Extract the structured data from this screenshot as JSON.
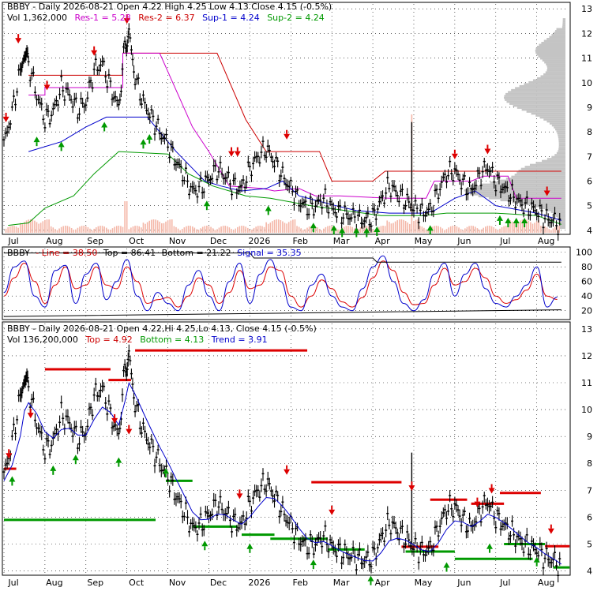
{
  "colors": {
    "bg": "#ffffff",
    "grid": "#000000",
    "price": "#000000",
    "volume": "#f4b7a8",
    "res1": "#cc00cc",
    "res2": "#cc0000",
    "sup1": "#0000cc",
    "sup2": "#009900",
    "profile": "#c4c4c4",
    "arrow_up": "#009900",
    "arrow_down": "#dd0000",
    "stoch_line": "#0000cc",
    "stoch_signal": "#dd0000",
    "stoch_bounds": "#000000",
    "top_line": "#dd0000",
    "bottom_line": "#009900",
    "trend_line": "#0000cc"
  },
  "months": [
    {
      "label": "Jul",
      "x": 0.0
    },
    {
      "label": "Aug",
      "x": 1.0
    },
    {
      "label": "Sep",
      "x": 2.0
    },
    {
      "label": "Oct",
      "x": 3.0
    },
    {
      "label": "Nov",
      "x": 4.0
    },
    {
      "label": "Dec",
      "x": 5.0
    },
    {
      "label": "2026",
      "x": 6.0
    },
    {
      "label": "Feb",
      "x": 7.0
    },
    {
      "label": "Mar",
      "x": 8.0
    },
    {
      "label": "Apr",
      "x": 9.0
    },
    {
      "label": "May",
      "x": 10.0
    },
    {
      "label": "Jun",
      "x": 11.0
    },
    {
      "label": "Jul",
      "x": 12.0
    },
    {
      "label": "Aug",
      "x": 13.0
    }
  ],
  "panel1": {
    "header": {
      "title": "BBBY - Daily 2026-08-21 Open 4.22  High 4.25  Low 4.13  Close 4.15 (-0.5%)",
      "vol": "Vol 1,362,000",
      "res1": "Res-1 = 5.28",
      "res2": "Res-2 = 6.37",
      "sup1": "Sup-1 = 4.24",
      "sup2": "Sup-2 = 4.24"
    },
    "y_ticks": [
      "4",
      "5",
      "6",
      "7",
      "8",
      "9",
      "10",
      "11",
      "12",
      "13"
    ]
  },
  "panel2": {
    "header": {
      "title": "BBBY",
      "line": "Line = 38.50",
      "top": "Top = 86.41",
      "bottom": "Bottom = 21.22",
      "signal": "Signal = 35.35"
    },
    "y_ticks": [
      "20",
      "40",
      "60",
      "80",
      "100"
    ]
  },
  "panel3": {
    "header": {
      "title": "BBBY - Daily 2026-08-21 Open 4.22,Hi 4.25,Lo 4.13, Close 4.15 (-0.5%)",
      "vol": "Vol 136,200,000",
      "top": "Top = 4.92",
      "bottom": "Bottom = 4.13",
      "trend": "Trend = 3.91"
    },
    "y_ticks": [
      "4",
      "5",
      "6",
      "7",
      "8",
      "9",
      "10",
      "11",
      "12",
      "13"
    ]
  },
  "chart_data": {
    "type": "line",
    "x_unit": "months since Jul 2025 start (0 = Jul, 13 = Aug 2026)",
    "price_close": {
      "x": [
        0.0,
        0.2,
        0.4,
        0.5,
        0.6,
        0.8,
        1.0,
        1.2,
        1.4,
        1.6,
        1.8,
        2.0,
        2.2,
        2.4,
        2.6,
        2.8,
        2.95,
        3.05,
        3.2,
        3.4,
        3.6,
        3.8,
        4.0,
        4.2,
        4.4,
        4.6,
        4.8,
        5.0,
        5.2,
        5.4,
        5.6,
        5.8,
        6.0,
        6.2,
        6.4,
        6.6,
        6.8,
        7.0,
        7.2,
        7.4,
        7.6,
        7.8,
        8.0,
        8.2,
        8.4,
        8.6,
        8.8,
        9.0,
        9.2,
        9.4,
        9.6,
        9.8,
        10.0,
        10.2,
        10.4,
        10.6,
        10.8,
        11.0,
        11.2,
        11.4,
        11.6,
        11.8,
        12.0,
        12.2,
        12.4,
        12.6,
        12.8,
        13.0,
        13.2,
        13.4,
        13.6
      ],
      "y": [
        7.5,
        8.8,
        10.5,
        11.2,
        10.8,
        9.5,
        8.5,
        8.8,
        9.8,
        9.5,
        8.9,
        9.2,
        10.5,
        10.8,
        9.8,
        9.0,
        11.5,
        12.0,
        10.2,
        9.2,
        8.6,
        8.0,
        7.5,
        6.8,
        6.2,
        5.6,
        5.7,
        6.1,
        6.5,
        6.2,
        5.8,
        5.7,
        6.5,
        7.0,
        7.3,
        6.8,
        6.2,
        5.7,
        5.2,
        4.9,
        5.0,
        5.3,
        4.9,
        4.7,
        4.6,
        4.5,
        4.4,
        4.5,
        5.2,
        5.8,
        5.5,
        5.2,
        4.9,
        4.7,
        4.8,
        5.6,
        6.3,
        6.4,
        5.9,
        5.6,
        6.2,
        6.6,
        6.0,
        5.7,
        5.4,
        5.1,
        4.9,
        4.8,
        4.5,
        4.4,
        4.15
      ]
    },
    "stochastic": {
      "line": {
        "x": [
          0.0,
          0.25,
          0.5,
          0.75,
          1.0,
          1.25,
          1.5,
          1.75,
          2.0,
          2.25,
          2.5,
          2.75,
          3.0,
          3.25,
          3.5,
          3.75,
          4.0,
          4.25,
          4.5,
          4.75,
          5.0,
          5.25,
          5.5,
          5.75,
          6.0,
          6.25,
          6.5,
          6.75,
          7.0,
          7.25,
          7.5,
          7.75,
          8.0,
          8.25,
          8.5,
          8.75,
          9.0,
          9.25,
          9.5,
          9.75,
          10.0,
          10.25,
          10.5,
          10.75,
          11.0,
          11.25,
          11.5,
          11.75,
          12.0,
          12.25,
          12.5,
          12.75,
          13.0,
          13.25,
          13.5
        ],
        "y": [
          45,
          80,
          88,
          40,
          25,
          75,
          82,
          30,
          70,
          85,
          35,
          60,
          90,
          40,
          20,
          45,
          30,
          20,
          55,
          75,
          40,
          20,
          60,
          85,
          30,
          70,
          90,
          60,
          25,
          20,
          55,
          70,
          40,
          25,
          20,
          50,
          80,
          95,
          60,
          30,
          20,
          35,
          70,
          85,
          40,
          70,
          85,
          50,
          30,
          25,
          40,
          55,
          80,
          25,
          38.5
        ]
      },
      "signal": {
        "x": [
          0.0,
          0.25,
          0.5,
          0.75,
          1.0,
          1.25,
          1.5,
          1.75,
          2.0,
          2.25,
          2.5,
          2.75,
          3.0,
          3.25,
          3.5,
          3.75,
          4.0,
          4.25,
          4.5,
          4.75,
          5.0,
          5.25,
          5.5,
          5.75,
          6.0,
          6.25,
          6.5,
          6.75,
          7.0,
          7.25,
          7.5,
          7.75,
          8.0,
          8.25,
          8.5,
          8.75,
          9.0,
          9.25,
          9.5,
          9.75,
          10.0,
          10.25,
          10.5,
          10.75,
          11.0,
          11.25,
          11.5,
          11.75,
          12.0,
          12.25,
          12.5,
          12.75,
          13.0,
          13.25,
          13.5
        ],
        "y": [
          40,
          65,
          85,
          60,
          30,
          55,
          80,
          50,
          55,
          80,
          55,
          50,
          80,
          60,
          30,
          35,
          38,
          25,
          40,
          65,
          55,
          30,
          45,
          75,
          50,
          55,
          80,
          75,
          40,
          25,
          40,
          62,
          50,
          32,
          25,
          38,
          65,
          88,
          75,
          45,
          28,
          30,
          55,
          78,
          55,
          60,
          78,
          65,
          40,
          30,
          35,
          48,
          70,
          40,
          35.35
        ]
      },
      "top": {
        "x": [
          0.0,
          6.0,
          6.1,
          9.0,
          9.1,
          13.6
        ],
        "y": [
          99,
          99,
          92,
          92,
          86.41,
          86.41
        ]
      },
      "bottom": {
        "x": [
          0.0,
          6.0,
          13.6
        ],
        "y": [
          12,
          16,
          21.22
        ]
      }
    },
    "y_ranges": {
      "price": [
        3.9,
        13.2
      ],
      "stochastic": [
        10,
        105
      ]
    }
  }
}
